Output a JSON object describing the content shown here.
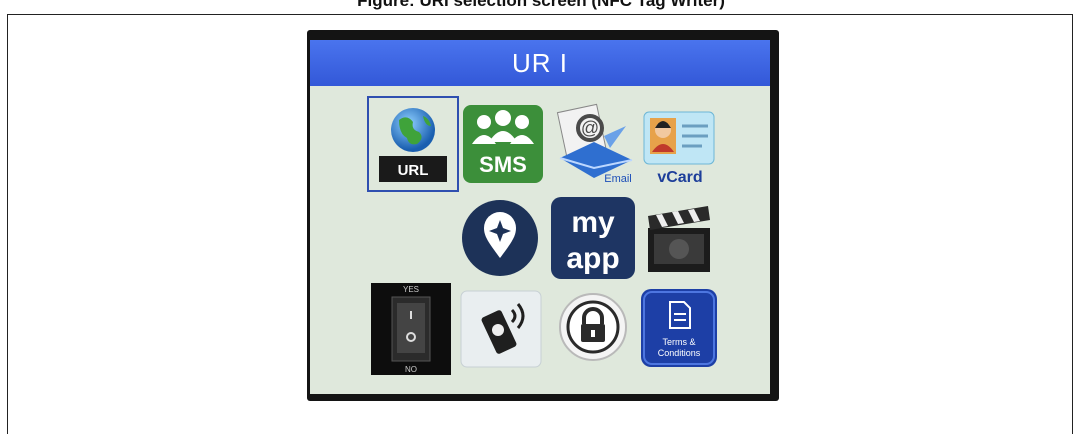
{
  "caption": "Figure: URI selection screen (NFC Tag Writer)",
  "screen": {
    "title": "UR I",
    "icons": [
      {
        "name": "url",
        "label": "URL",
        "selected": true
      },
      {
        "name": "sms",
        "label": "SMS"
      },
      {
        "name": "email",
        "label": "Email"
      },
      {
        "name": "vcard",
        "label": "vCard"
      },
      {
        "name": "location",
        "label": ""
      },
      {
        "name": "myapp",
        "label_top": "my",
        "label_bottom": "app"
      },
      {
        "name": "video",
        "label": ""
      },
      {
        "name": "switch",
        "label_top": "YES",
        "label_bottom": "NO"
      },
      {
        "name": "nfc-phone",
        "label": ""
      },
      {
        "name": "lock",
        "label": ""
      },
      {
        "name": "terms",
        "label_top": "Terms &",
        "label_bottom": "Conditions"
      }
    ]
  },
  "colors": {
    "title_bar": "#3358d8",
    "screen_bg": "#dfe8dc",
    "sms_green": "#3c8f3a",
    "myapp_navy": "#1e3563",
    "terms_blue": "#1d3fa6"
  }
}
